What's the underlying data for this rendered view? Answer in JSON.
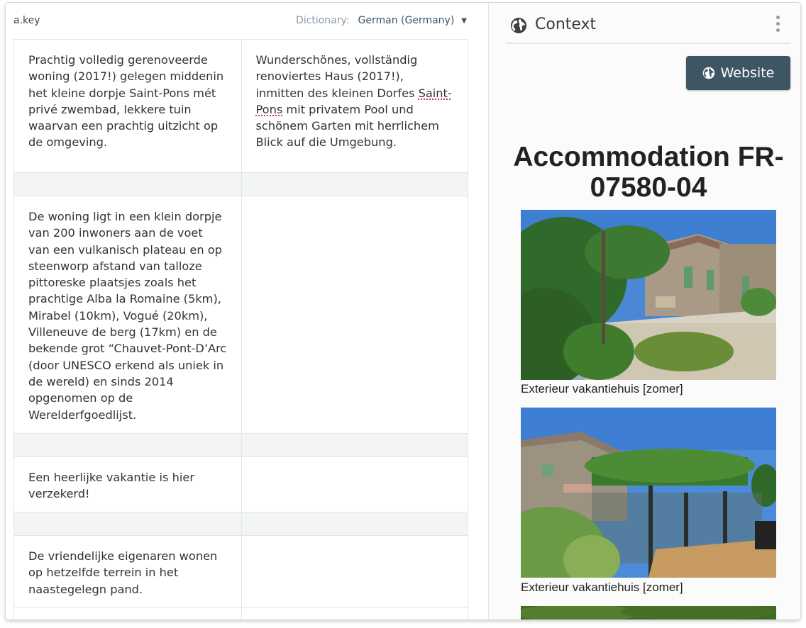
{
  "left": {
    "key_label": "a.key",
    "dictionary_label": "Dictionary:",
    "dictionary_value": "German (Germany)",
    "rows": [
      {
        "source": "Prachtig volledig gerenoveerde woning (2017!) gelegen middenin het kleine dorpje Saint-Pons mét privé zwembad, lekkere tuin waarvan een prachtig uitzicht op de omgeving.",
        "target_before": "Wunderschönes, vollständig renoviertes Haus (2017!), inmitten des kleinen Dorfes ",
        "target_spell": "Saint-Pons",
        "target_after": " mit privatem Pool und schönem Garten mit herrlichem Blick auf die Umgebung."
      },
      {
        "source": "De woning ligt in een klein dorpje van 200 inwoners aan de voet van een vulkanisch plateau en op steenworp afstand van talloze pittoreske plaatsjes zoals het prachtige Alba la Romaine (5km), Mirabel (10km), Vogué (20km), Villeneuve de berg (17km) en de bekende grot “Chauvet-Pont-D’Arc (door UNESCO erkend als uniek in de wereld) en sinds 2014 opgenomen op de Werelderfgoedlijst.",
        "target": ""
      },
      {
        "source": "Een heerlijke vakantie is hier verzekerd!",
        "target": ""
      },
      {
        "source": "De vriendelijke eigenaren wonen op hetzelfde terrein in het naastegelegn pand.",
        "target": ""
      }
    ]
  },
  "right": {
    "header_title": "Context",
    "website_button": "Website",
    "accommodation_title": "Accommodation FR-07580-04",
    "photos": [
      {
        "caption": "Exterieur vakantiehuis [zomer]"
      },
      {
        "caption": "Exterieur vakantiehuis [zomer]"
      }
    ]
  },
  "icons": [
    "globe-icon",
    "kebab-menu-icon",
    "caret-down-icon"
  ],
  "colors": {
    "button_bg": "#3e5564",
    "dictionary_text": "#3d5466",
    "spellcheck_underline": "#d0021b"
  }
}
